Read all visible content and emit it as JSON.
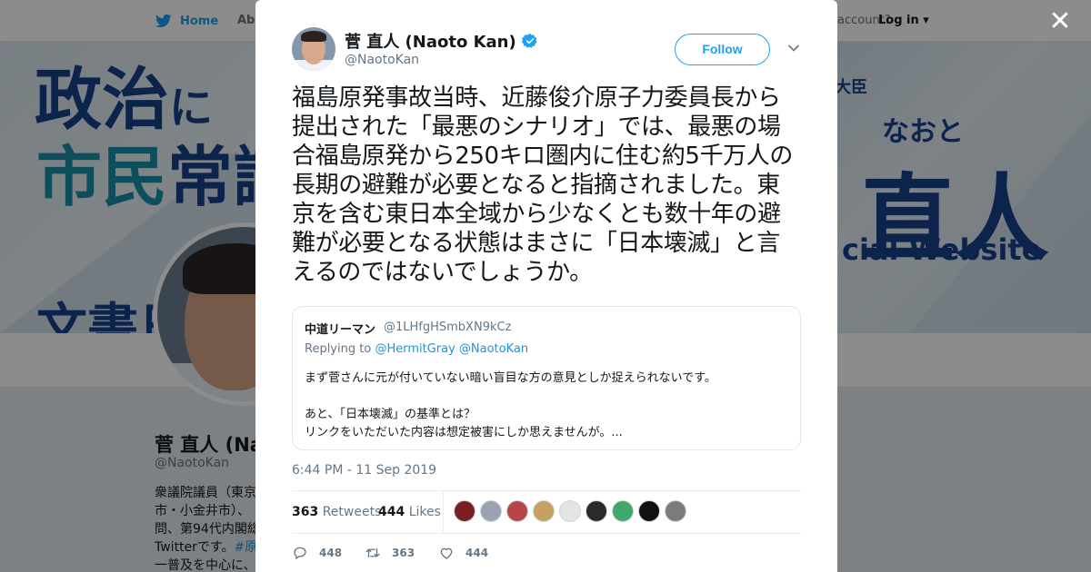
{
  "background": {
    "nav": {
      "home": "Home",
      "about": "Abo",
      "account": "account?",
      "login": "Log in"
    },
    "banner": {
      "line1_main": "政治",
      "line1_small": "に",
      "line2_teal": "市民",
      "line2_dark": "常識",
      "line3": "文書日",
      "right_small": "大臣",
      "right_reading": "なおと",
      "right_name": "直人",
      "right_site": "cial Website"
    },
    "profile": {
      "name": "菅 直人 (Na",
      "handle": "@NaotoKan",
      "bio_lines": [
        "衆議院議員（東京",
        "市・小金井市）、",
        "問、第94代内閣総",
        "Twitterです。"
      ],
      "bio_tag": "#原発",
      "bio_last": "一普及を中心に、"
    }
  },
  "modal": {
    "author": {
      "name": "菅 直人 (Naoto Kan)",
      "handle": "@NaotoKan",
      "verified": true
    },
    "follow_label": "Follow",
    "tweet_text": "福島原発事故当時、近藤俊介原子力委員長から提出された「最悪のシナリオ」では、最悪の場合福島原発から250キロ圏内に住む約5千万人の長期の避難が必要となると指摘されました。東京を含む東日本全域から少なくとも数十年の避難が必要となる状態はまさに「日本壊滅」と言えるのではないでしょうか。",
    "quoted": {
      "name": "中道リーマン",
      "handle": "@1LHfgHSmbXN9kCz",
      "replying_prefix": "Replying to",
      "replying_to": "@HermitGray @NaotoKan",
      "line1": "まず菅さんに元が付いていない暗い盲目な方の意見としか捉えられないです。",
      "line2": "あと、「日本壊滅」の基準とは？",
      "line3": "リンクをいただいた内容は想定被害にしか思えませんが。..."
    },
    "timestamp": "6:44 PM - 11 Sep 2019",
    "stats": {
      "retweets_count": "363",
      "retweets_label": "Retweets",
      "likes_count": "444",
      "likes_label": "Likes"
    },
    "liker_colors": [
      "#7a1f22",
      "#9aa4b1",
      "#b8454a",
      "#c8a060",
      "#e4e4e0",
      "#2a2a2a",
      "#3fa86a",
      "#111111",
      "#7b7b7b"
    ],
    "actions": {
      "replies": "448",
      "retweets": "363",
      "likes": "444"
    }
  },
  "colors": {
    "accent": "#1da1f2",
    "text": "#14171a",
    "muted": "#657786"
  }
}
